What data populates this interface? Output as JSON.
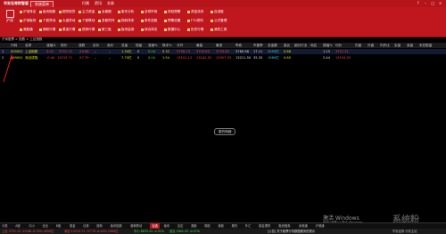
{
  "titlebar": {
    "app_name": "华安证券财智版",
    "menu_label": "系统菜单",
    "tabs": [
      "行情",
      "资讯",
      "交易"
    ],
    "controls": [
      "?",
      "–",
      "□",
      "×"
    ]
  },
  "ribbon": {
    "big_button": "沪深",
    "buttons": [
      [
        "沪深排名",
        "板块指数",
        "期货现货",
        "主力资金",
        "全景图",
        "股东分析",
        "全球市场",
        "风险预警",
        "资金流向",
        "自选股"
      ],
      [
        "沪深板块",
        "个股异动",
        "大盘异动",
        "个股联动",
        "多股同列",
        "指标排序",
        "条件选股",
        "预警设置",
        "F10资料",
        "公式管理"
      ],
      [
        "港股通",
        "期权行情",
        "基金行情",
        "债券行情",
        "新三板",
        "板块监测",
        "综合排名",
        "数据中心",
        "历史行情",
        "我的工具"
      ]
    ]
  },
  "breadcrumb": "沪深股票 > 指数 > 上证指数",
  "table": {
    "headers": [
      "代码",
      "名称",
      "涨幅%",
      "现价",
      "涨跌",
      "买价",
      "卖价",
      "总量",
      "现量",
      "涨速%",
      "换手%",
      "今开",
      "最高",
      "最低",
      "昨收",
      "市盈率",
      "总金额",
      "量比",
      "细分行业",
      "地区",
      "振幅%",
      "均价",
      "内盘",
      "外盘",
      "内外比",
      "买量",
      "卖量",
      "未匹配量"
    ],
    "rows": [
      {
        "idx": "1",
        "code": "000001",
        "name": "上证指数",
        "pct": "0.02",
        "price": "3751.12",
        "chg": "-29.86",
        "buy": "–",
        "sell": "–",
        "vol": "1.30亿",
        "cur": "0",
        "spd": "0.04",
        "turn": "0.32",
        "open": "3756.13",
        "high": "3759.63",
        "low": "3733.65",
        "prev": "3780.98",
        "pe": "17.11",
        "amt": "2055亿",
        "ratio": "0.88",
        "amp": "1.15",
        "avg": "3751.31"
      },
      {
        "idx": "2",
        "code": "399001",
        "name": "深证成指",
        "pct": "-0.44",
        "price": "13153.71",
        "chg": "-57.79",
        "buy": "–",
        "sell": "–",
        "vol": "7.70亿",
        "cur": "0",
        "spd": "0.04",
        "turn": "1.54",
        "open": "13101.13",
        "high": "13242.52",
        "low": "12927.53",
        "prev": "13211.50",
        "pe": "35.33",
        "amt": "1989亿",
        "ratio": "0.80",
        "amp": "2.44",
        "avg": "13154.02"
      }
    ]
  },
  "center_button": "委托明细",
  "bottom_tabs": [
    "分类",
    "A股",
    "中小",
    "创业",
    "B股",
    "基金",
    "债券",
    "股转",
    "板块指数",
    "港美联动",
    "自选",
    "板块",
    "自定",
    "港股",
    "期权",
    "美股",
    "期货",
    "外汇",
    "基金理财",
    "融资融券",
    "深港通",
    "沪港通"
  ],
  "active_tab": "自选",
  "status": {
    "items": [
      "上证 3751.12 -29.86 -0.79% 2055亿",
      "深证 13153.71 -57.79 -0.44% 1989亿",
      "中小 8875.23 -0.31%",
      "创业 2901.52 -0.57%"
    ],
    "notice": "[公告] 关于股票行情数据服务的提示",
    "right": "华安证券 行情主站"
  },
  "watermark": {
    "title": "激活 Windows",
    "subtitle": "转到\"设置\"以激活 Windows。",
    "logo": "系统粉"
  }
}
